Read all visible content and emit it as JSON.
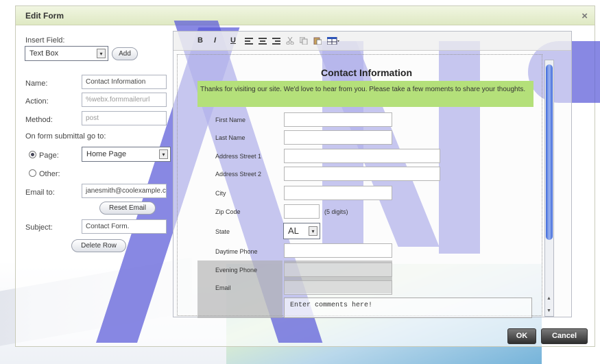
{
  "dialog": {
    "title": "Edit Form",
    "close_glyph": "×",
    "ok_label": "OK",
    "cancel_label": "Cancel"
  },
  "left_panel": {
    "insert_field_label": "Insert Field:",
    "insert_field_value": "Text Box",
    "add_label": "Add",
    "name_label": "Name:",
    "name_value": "Contact Information",
    "action_label": "Action:",
    "action_value": "%webx.formmailerurl",
    "method_label": "Method:",
    "method_value": "post",
    "submit_goto_label": "On form submittal go to:",
    "page_label": "Page:",
    "page_value": "Home Page",
    "other_label": "Other:",
    "email_label": "Email to:",
    "email_value": "janesmith@coolexample.com",
    "reset_email_label": "Reset Email",
    "subject_label": "Subject:",
    "subject_value": "Contact Form.",
    "delete_row_label": "Delete Row"
  },
  "editor": {
    "toolbar": {
      "bold": "B",
      "italic": "I",
      "underline": "U"
    },
    "form_title": "Contact Information",
    "intro_text": "Thanks for visiting our site. We'd love to hear from you. Please take a few moments to share your thoughts.",
    "fields": [
      "First Name",
      "Last Name",
      "Address Street 1",
      "Address Street 2",
      "City",
      "Zip Code",
      "State",
      "Daytime Phone",
      "Evening Phone",
      "Email"
    ],
    "zip_hint": "(5 digits)",
    "state_value": "AL",
    "comments_placeholder": "Enter comments here!"
  },
  "colors": {
    "title_bar": "#e4edcb",
    "intro_bg": "#b4e07a",
    "scroll_thumb": "#3d67d9",
    "watermark": "#5a5ad8"
  }
}
